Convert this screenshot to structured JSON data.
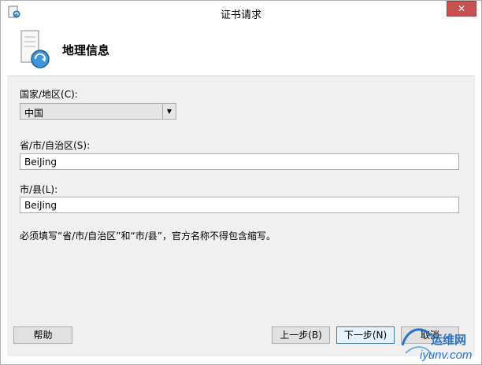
{
  "window": {
    "title": "证书请求",
    "close_label": "✕"
  },
  "header": {
    "title": "地理信息"
  },
  "form": {
    "country_label": "国家/地区(C):",
    "country_value": "中国",
    "province_label": "省/市/自治区(S):",
    "province_value": "BeiJing",
    "city_label": "市/县(L):",
    "city_value": "BeiJing",
    "note": "必须填写“省/市/自治区”和“市/县”，官方名称不得包含缩写。"
  },
  "buttons": {
    "help": "帮助",
    "back": "上一步(B)",
    "next": "下一步(N)",
    "cancel": "取消"
  },
  "watermark": {
    "line1": "运维网",
    "line2": "iyunv.com"
  },
  "colors": {
    "close_bg": "#c75050",
    "body_bg": "#f0f0f0",
    "watermark": "#2a73c7"
  },
  "icons": {
    "app": "certificate-app-icon",
    "header": "certificate-server-icon",
    "dropdown": "triangle-down-icon"
  }
}
